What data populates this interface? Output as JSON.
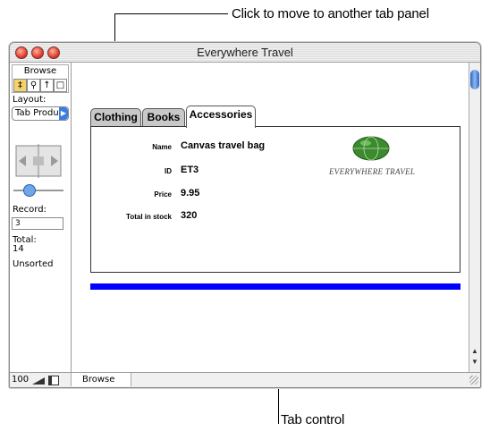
{
  "callouts": {
    "top": "Click to move to another tab panel",
    "bottom": "Tab control"
  },
  "window": {
    "title": "Everywhere Travel"
  },
  "sidebar": {
    "mode_label": "Browse",
    "layout_label": "Layout:",
    "layout_value": "Tab Produ",
    "record_label": "Record:",
    "record_value": "3",
    "total_label": "Total:",
    "total_value": "14",
    "sort_status": "Unsorted"
  },
  "tabs": [
    {
      "label": "Clothing",
      "active": false
    },
    {
      "label": "Books",
      "active": false
    },
    {
      "label": "Accessories",
      "active": true
    }
  ],
  "record": {
    "fields": [
      {
        "label": "Name",
        "value": "Canvas travel bag"
      },
      {
        "label": "ID",
        "value": "ET3"
      },
      {
        "label": "Price",
        "value": "9.95"
      },
      {
        "label": "Total in stock",
        "value": "320"
      }
    ]
  },
  "logo": {
    "text": "EVERYWHERE TRAVEL"
  },
  "statusbar": {
    "zoom": "100",
    "mode": "Browse"
  },
  "colors": {
    "tab_control_bar": "#0000ff",
    "accent": "#3a7ee0"
  }
}
